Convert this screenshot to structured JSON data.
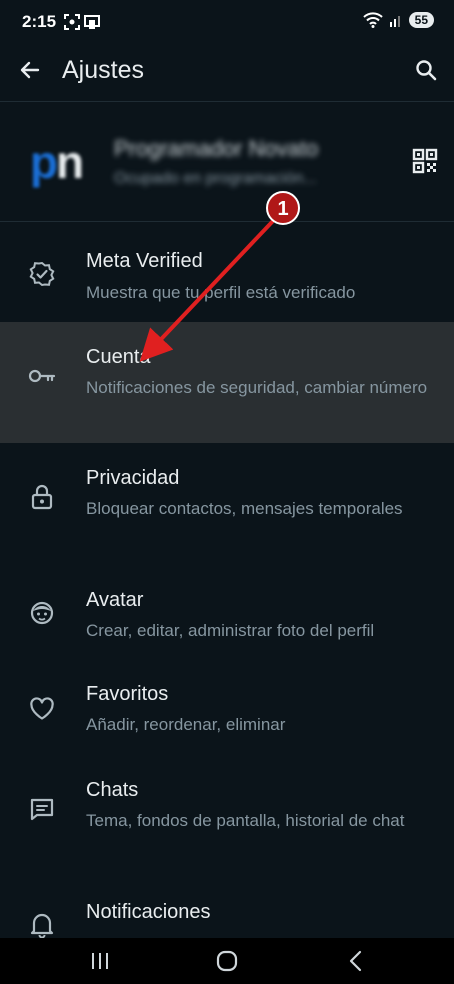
{
  "status_bar": {
    "time": "2:15",
    "battery": "55"
  },
  "app_bar": {
    "title": "Ajustes"
  },
  "profile": {
    "name": "Programador Novato",
    "status": "Ocupado en programación..."
  },
  "settings": [
    {
      "title": "Meta Verified",
      "subtitle": "Muestra que tu perfil está verificado",
      "icon": "verified-badge-icon"
    },
    {
      "title": "Cuenta",
      "subtitle": "Notificaciones de seguridad, cambiar número",
      "icon": "key-icon"
    },
    {
      "title": "Privacidad",
      "subtitle": "Bloquear contactos, mensajes temporales",
      "icon": "lock-icon"
    },
    {
      "title": "Avatar",
      "subtitle": "Crear, editar, administrar foto del perfil",
      "icon": "avatar-face-icon"
    },
    {
      "title": "Favoritos",
      "subtitle": "Añadir, reordenar, eliminar",
      "icon": "heart-icon"
    },
    {
      "title": "Chats",
      "subtitle": "Tema, fondos de pantalla, historial de chat",
      "icon": "chat-icon"
    },
    {
      "title": "Notificaciones",
      "subtitle": "",
      "icon": "bell-icon"
    }
  ],
  "annotation": {
    "step": "1"
  },
  "colors": {
    "background": "#0b141a",
    "highlight": "#2a2f32",
    "accent_red": "#e02020",
    "subtitle": "#8696a0"
  }
}
